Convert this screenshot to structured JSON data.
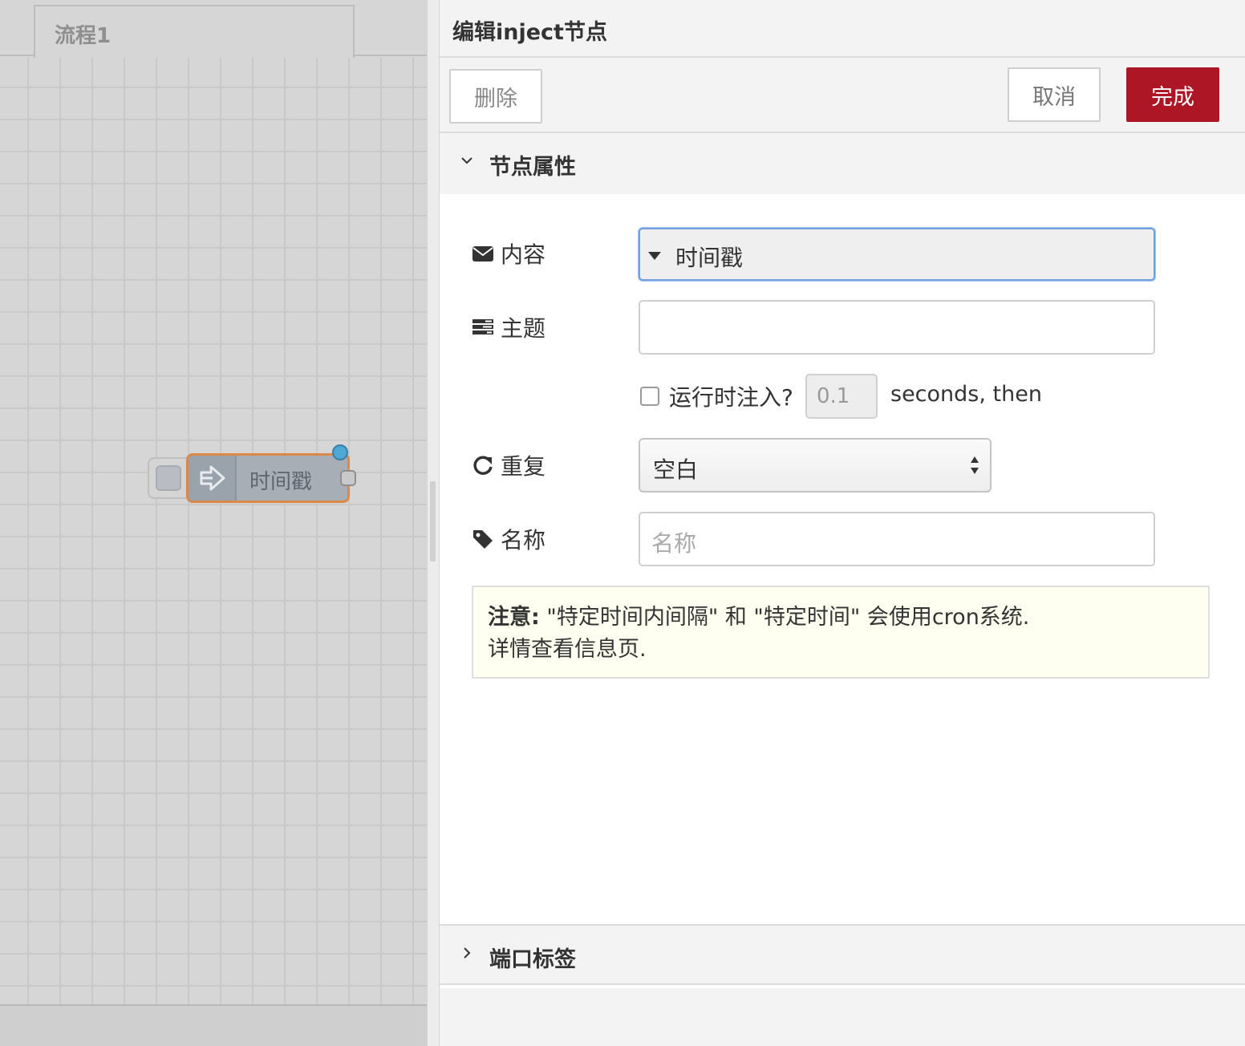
{
  "workspace": {
    "tab_label": "流程1",
    "node": {
      "label": "时间戳",
      "colors": {
        "fill": "#a7aeb6",
        "selected_border": "#d9894a",
        "status": "#4fa8d6"
      }
    }
  },
  "editor": {
    "title": "编辑inject节点",
    "buttons": {
      "delete": "删除",
      "cancel": "取消",
      "done": "完成"
    },
    "colors": {
      "done_bg": "#ad1625",
      "focus_border": "#6fa0de",
      "tip_bg": "#fefff0"
    },
    "sections": {
      "properties": "节点属性",
      "port_labels": "端口标签"
    },
    "form": {
      "payload": {
        "label": "内容",
        "icon": "envelope-icon",
        "value": "时间戳"
      },
      "topic": {
        "label": "主题",
        "icon": "tasks-icon",
        "value": ""
      },
      "once": {
        "label": "运行时注入?",
        "delay_value": "0.1",
        "suffix": "seconds, then",
        "checked": false
      },
      "repeat": {
        "label": "重复",
        "icon": "repeat-icon",
        "value": "空白"
      },
      "name": {
        "label": "名称",
        "icon": "tag-icon",
        "placeholder": "名称",
        "value": ""
      }
    },
    "tip": {
      "strong": "注意:",
      "line1": " \"特定时间内间隔\" 和 \"特定时间\" 会使用cron系统.",
      "line2": "详情查看信息页."
    }
  }
}
